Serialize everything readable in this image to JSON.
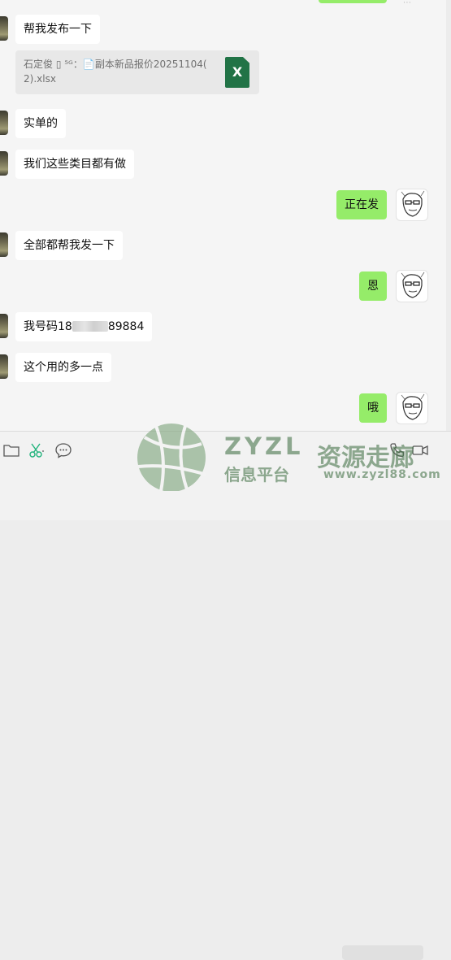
{
  "messages": {
    "m1": "帮我发布一下",
    "file": {
      "line1": "石定俊 ▯ ⁵ᴳ：📄副本新品报价20251104(",
      "line2": "2).xlsx",
      "badge": "X"
    },
    "m2": "实单的",
    "m3": "我们这些类目都有做",
    "m4": "正在发",
    "m5": "全部都帮我发一下",
    "m6": "恩",
    "m7_prefix": "我号码18",
    "m7_suffix": "89884",
    "m8": "这个用的多一点",
    "m9": "哦"
  },
  "watermark": {
    "title": "ZYZL",
    "sub": "信息平台",
    "big": "资源走廊",
    "url": "www.zyzl88.com"
  },
  "icons": {
    "folder": "folder-icon",
    "scissors": "scissors-icon",
    "chat": "chat-bubble-icon",
    "phone": "phone-icon",
    "video": "video-icon"
  },
  "colors": {
    "chat_bg": "#f5f5f5",
    "right_bubble": "#95ec69",
    "left_bubble": "#ffffff",
    "accent_green": "#20b37c",
    "excel_green": "#217346",
    "watermark": "#4f7a52"
  }
}
